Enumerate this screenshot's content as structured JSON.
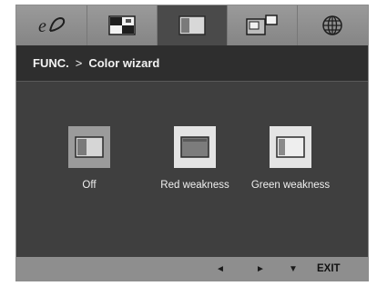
{
  "tabs": [
    {
      "name": "picture-mode",
      "icon": "ez-picture-icon",
      "active": false
    },
    {
      "name": "picture",
      "icon": "picture-adjust-icon",
      "active": false
    },
    {
      "name": "color",
      "icon": "color-wizard-icon",
      "active": true
    },
    {
      "name": "pip",
      "icon": "pip-icon",
      "active": false
    },
    {
      "name": "setup",
      "icon": "globe-icon",
      "active": false
    }
  ],
  "header": {
    "section": "FUNC.",
    "separator": ">",
    "page": "Color wizard"
  },
  "options": [
    {
      "label": "Off",
      "selected": true
    },
    {
      "label": "Red weakness",
      "selected": false
    },
    {
      "label": "Green weakness",
      "selected": false
    }
  ],
  "bottom_bar": {
    "left_label": "◄",
    "right_label": "►",
    "down_label": "▼",
    "exit_label": "EXIT"
  },
  "colors": {
    "panel": "#3f3f3f",
    "tabbar": "#8e8e8e",
    "header": "#2e2e2e",
    "selected_box": "#9b9b9b",
    "option_box": "#e4e4e4"
  }
}
